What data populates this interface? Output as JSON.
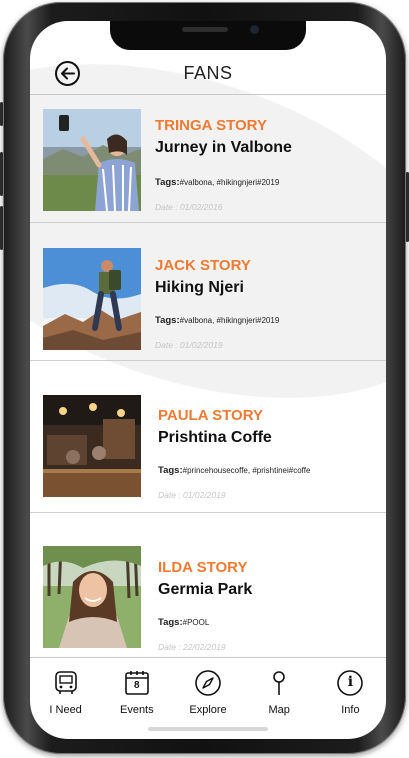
{
  "header": {
    "title": "FANS"
  },
  "stories": [
    {
      "title": "TRINGA STORY",
      "subtitle": "Jurney in Valbone",
      "tags_label": "Tags:",
      "tags": "#valbona, #hikingnjeri#2019",
      "date": "Date : 01/02/2016"
    },
    {
      "title": "JACK STORY",
      "subtitle": "Hiking Njeri",
      "tags_label": "Tags:",
      "tags": "#valbona, #hikingnjeri#2019",
      "date": "Date : 01/02/2019"
    },
    {
      "title": "PAULA STORY",
      "subtitle": "Prishtina Coffe",
      "tags_label": "Tags:",
      "tags": "#princehousecoffe, #prishtinei#coffe",
      "date": "Date : 01/02/2019"
    },
    {
      "title": "ILDA STORY",
      "subtitle": "Germia Park",
      "tags_label": "Tags:",
      "tags": "#POOL",
      "date": "Date : 22/02/2019"
    }
  ],
  "tabs": [
    {
      "label": "I Need",
      "icon": "bus-icon"
    },
    {
      "label": "Events",
      "icon": "calendar-icon",
      "icon_text": "8"
    },
    {
      "label": "Explore",
      "icon": "compass-icon"
    },
    {
      "label": "Map",
      "icon": "map-pin-icon"
    },
    {
      "label": "Info",
      "icon": "info-icon",
      "icon_text": "i"
    }
  ],
  "colors": {
    "accent": "#ef7b32",
    "text": "#111111",
    "date": "#c5c5c5",
    "divider": "#cfcfcf"
  }
}
